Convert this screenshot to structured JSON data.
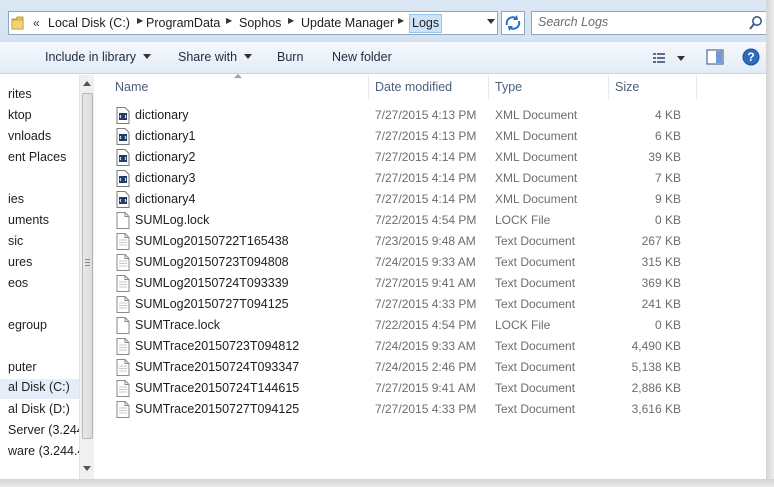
{
  "window": {
    "breadcrumbs": [
      "Local Disk (C:)",
      "ProgramData",
      "Sophos",
      "Update Manager",
      "Logs"
    ],
    "overflow_chevron": "«",
    "search_placeholder": "Search Logs"
  },
  "toolbar": {
    "include_library": "Include in library",
    "share_with": "Share with",
    "burn": "Burn",
    "new_folder": "New folder"
  },
  "nav": {
    "items": [
      {
        "label": "rites"
      },
      {
        "label": "ktop"
      },
      {
        "label": "vnloads"
      },
      {
        "label": "ent Places"
      },
      {
        "label": "ies"
      },
      {
        "label": "uments"
      },
      {
        "label": "sic"
      },
      {
        "label": "ures"
      },
      {
        "label": "eos"
      },
      {
        "label": "egroup"
      },
      {
        "label": "puter"
      },
      {
        "label": "al Disk (C:)"
      },
      {
        "label": "al Disk (D:)"
      },
      {
        "label": "Server (3.244."
      },
      {
        "label": "ware (3.244.4"
      }
    ],
    "selected": "al Disk (C:)"
  },
  "columns": {
    "name": "Name",
    "date": "Date modified",
    "type": "Type",
    "size": "Size"
  },
  "files": [
    {
      "name": "dictionary",
      "date": "7/27/2015 4:13 PM",
      "type": "XML Document",
      "size": "4 KB",
      "icon": "xml-file-icon"
    },
    {
      "name": "dictionary1",
      "date": "7/27/2015 4:13 PM",
      "type": "XML Document",
      "size": "6 KB",
      "icon": "xml-file-icon"
    },
    {
      "name": "dictionary2",
      "date": "7/27/2015 4:14 PM",
      "type": "XML Document",
      "size": "39 KB",
      "icon": "xml-file-icon"
    },
    {
      "name": "dictionary3",
      "date": "7/27/2015 4:14 PM",
      "type": "XML Document",
      "size": "7 KB",
      "icon": "xml-file-icon"
    },
    {
      "name": "dictionary4",
      "date": "7/27/2015 4:14 PM",
      "type": "XML Document",
      "size": "9 KB",
      "icon": "xml-file-icon"
    },
    {
      "name": "SUMLog.lock",
      "date": "7/22/2015 4:54 PM",
      "type": "LOCK File",
      "size": "0 KB",
      "icon": "blank-file-icon"
    },
    {
      "name": "SUMLog20150722T165438",
      "date": "7/23/2015 9:48 AM",
      "type": "Text Document",
      "size": "267 KB",
      "icon": "text-file-icon"
    },
    {
      "name": "SUMLog20150723T094808",
      "date": "7/24/2015 9:33 AM",
      "type": "Text Document",
      "size": "315 KB",
      "icon": "text-file-icon"
    },
    {
      "name": "SUMLog20150724T093339",
      "date": "7/27/2015 9:41 AM",
      "type": "Text Document",
      "size": "369 KB",
      "icon": "text-file-icon"
    },
    {
      "name": "SUMLog20150727T094125",
      "date": "7/27/2015 4:33 PM",
      "type": "Text Document",
      "size": "241 KB",
      "icon": "text-file-icon"
    },
    {
      "name": "SUMTrace.lock",
      "date": "7/22/2015 4:54 PM",
      "type": "LOCK File",
      "size": "0 KB",
      "icon": "blank-file-icon"
    },
    {
      "name": "SUMTrace20150723T094812",
      "date": "7/24/2015 9:33 AM",
      "type": "Text Document",
      "size": "4,490 KB",
      "icon": "text-file-icon"
    },
    {
      "name": "SUMTrace20150724T093347",
      "date": "7/24/2015 2:46 PM",
      "type": "Text Document",
      "size": "5,138 KB",
      "icon": "text-file-icon"
    },
    {
      "name": "SUMTrace20150724T144615",
      "date": "7/27/2015 9:41 AM",
      "type": "Text Document",
      "size": "2,886 KB",
      "icon": "text-file-icon"
    },
    {
      "name": "SUMTrace20150727T094125",
      "date": "7/27/2015 4:33 PM",
      "type": "Text Document",
      "size": "3,616 KB",
      "icon": "text-file-icon"
    }
  ],
  "colors": {
    "address_bar_bg": "#dce8f5",
    "selection": "#cde3f8",
    "header_text": "#4c607a",
    "detail_text": "#6d6d6d"
  }
}
